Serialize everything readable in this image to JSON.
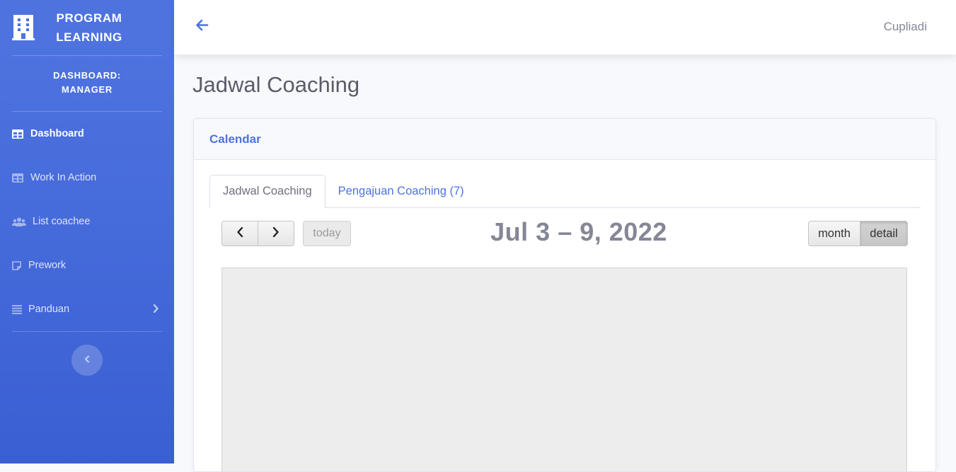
{
  "sidebar": {
    "brand": {
      "icon": "building-icon",
      "line1": "PROGRAM",
      "line2": "LEARNING"
    },
    "heading": {
      "line1": "DASHBOARD:",
      "line2": "MANAGER"
    },
    "items": [
      {
        "label": "Dashboard",
        "icon": "table-icon",
        "active": true
      },
      {
        "label": "Work In Action",
        "icon": "table-icon",
        "active": false
      },
      {
        "label": "List coachee",
        "icon": "users-icon",
        "active": false
      },
      {
        "label": "Prework",
        "icon": "sticky-note-icon",
        "active": false
      },
      {
        "label": "Panduan",
        "icon": "list-icon",
        "active": false,
        "has_submenu": true
      }
    ],
    "toggle_icon": "chevron-left-icon"
  },
  "topbar": {
    "back_icon": "arrow-left-icon",
    "username": "Cupliadi"
  },
  "page": {
    "title": "Jadwal Coaching"
  },
  "card": {
    "header": "Calendar",
    "tabs": [
      {
        "label": "Jadwal Coaching",
        "active": true
      },
      {
        "label": "Pengajuan Coaching (7)",
        "active": false
      }
    ]
  },
  "calendar": {
    "prev_icon": "chevron-left-icon",
    "next_icon": "chevron-right-icon",
    "today_label": "today",
    "title": "Jul 3 – 9, 2022",
    "views": [
      {
        "label": "month",
        "active": false
      },
      {
        "label": "detail",
        "active": true
      }
    ]
  },
  "colors": {
    "primary": "#4e73df",
    "text_muted": "#858796",
    "heading_text": "#5a5c69"
  }
}
